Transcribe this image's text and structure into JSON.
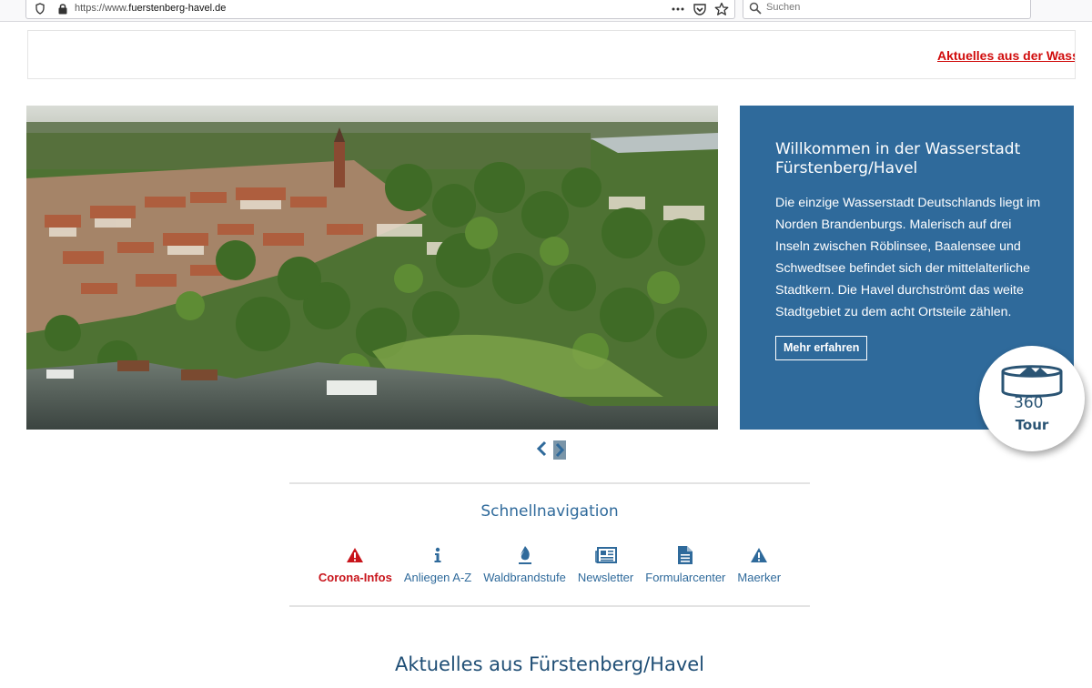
{
  "browser": {
    "url_prefix": "https://www.",
    "url_domain": "fuerstenberg-havel.de",
    "search_placeholder": "Suchen"
  },
  "ticker": {
    "text": "Aktuelles aus der Wasse"
  },
  "welcome": {
    "title": "Willkommen in der Wasserstadt Fürstenberg/Havel",
    "text": "Die einzige Wasserstadt Deutschlands liegt im Norden Brandenburgs. Malerisch auf drei Inseln zwischen Röblinsee, Baalensee und Schwedtsee befindet sich der mittelalterliche Stadtkern. Die Havel durchströmt das weite Stadtgebiet zu dem acht Ortsteile zählen.",
    "button": "Mehr erfahren"
  },
  "tour": {
    "number": "360",
    "label": "Tour"
  },
  "quicknav": {
    "title": "Schnellnavigation",
    "items": [
      {
        "label": "Corona-Infos",
        "icon": "warning-icon"
      },
      {
        "label": "Anliegen A-Z",
        "icon": "info-icon"
      },
      {
        "label": "Waldbrandstufe",
        "icon": "fire-icon"
      },
      {
        "label": "Newsletter",
        "icon": "newspaper-icon"
      },
      {
        "label": "Formularcenter",
        "icon": "document-icon"
      },
      {
        "label": "Maerker",
        "icon": "warning-icon"
      }
    ]
  },
  "news": {
    "heading": "Aktuelles aus Fürstenberg/Havel"
  },
  "colors": {
    "accent": "#2f6a9b",
    "alert": "#c8141b",
    "ticker": "#d00b0b"
  }
}
